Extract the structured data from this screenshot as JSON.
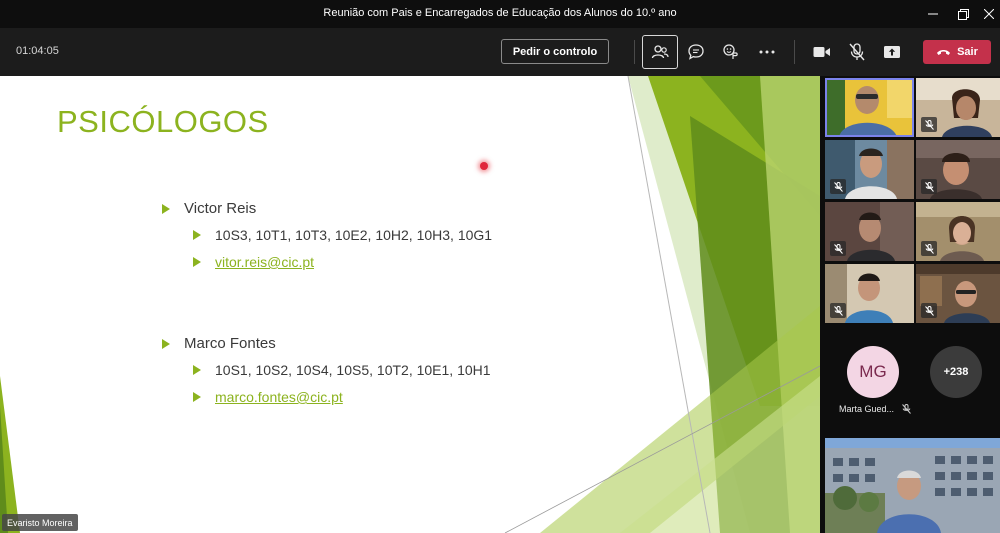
{
  "window": {
    "title": "Reunião com Pais e Encarregados de Educação dos Alunos do 10.º ano"
  },
  "meeting": {
    "elapsed": "01:04:05",
    "request_control_label": "Pedir o controlo",
    "leave_label": "Sair",
    "leave_color": "#c4314b",
    "toolbar_icons": [
      "people-icon",
      "chat-icon",
      "reactions-icon",
      "more-icon",
      "camera-icon",
      "mic-off-icon",
      "share-icon"
    ]
  },
  "slide": {
    "title": "PSICÓLOGOS",
    "accent_color": "#8cb31f",
    "sections": [
      {
        "name": "Victor Reis",
        "classes": "10S3, 10T1, 10T3, 10E2, 10H2, 10H3, 10G1",
        "email": "vitor.reis@cic.pt"
      },
      {
        "name": "Marco Fontes",
        "classes": "10S1, 10S2, 10S4, 10S5, 10T2, 10E1, 10H1",
        "email": "marco.fontes@cic.pt"
      }
    ],
    "presenter_name": "Evaristo Moreira"
  },
  "participants": {
    "avatar_initials": "MG",
    "avatar_name": "Marta Gued...",
    "overflow_count": "+238"
  }
}
